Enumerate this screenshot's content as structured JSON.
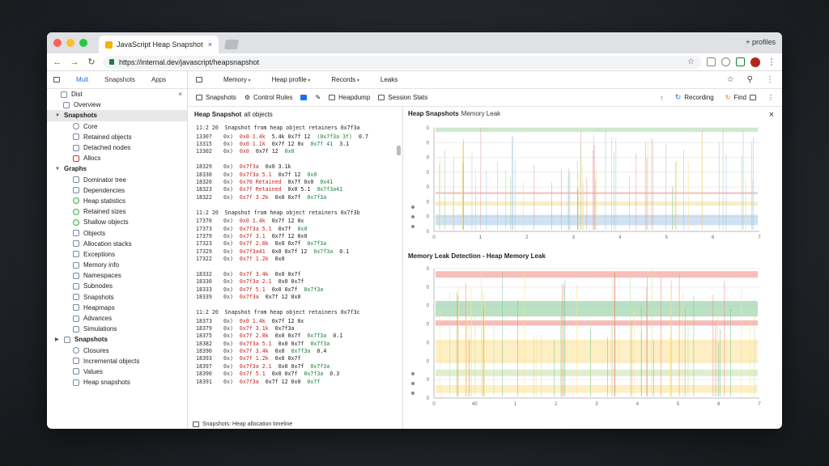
{
  "browser": {
    "tab_title": "JavaScript Heap Snapshot",
    "tab_close": "×",
    "window_label": "+ profiles",
    "url": "https://internal.dev/javascript/heapsnapshot",
    "traffic_lights": [
      "#ff5f57",
      "#febc2e",
      "#28c840"
    ]
  },
  "sidebar": {
    "tabs": [
      "Mult",
      "Snapshots",
      "Apps"
    ],
    "items": [
      {
        "label": "Dist",
        "kind": "root",
        "icon": "square-icon"
      },
      {
        "label": "Overview",
        "kind": "leaf",
        "icon": "square-icon"
      },
      {
        "label": "Snapshots",
        "kind": "group",
        "icon": "none"
      },
      {
        "label": "Core",
        "kind": "leaf",
        "icon": "circle-icon"
      },
      {
        "label": "Retained objects",
        "kind": "leaf",
        "icon": "square-icon"
      },
      {
        "label": "Detached nodes",
        "kind": "leaf",
        "icon": "square-icon"
      },
      {
        "label": "Allocs",
        "kind": "leaf",
        "icon": "red-icon"
      },
      {
        "label": "Graphs",
        "kind": "group",
        "icon": "none"
      },
      {
        "label": "Dominator tree",
        "kind": "leaf",
        "icon": "square-icon"
      },
      {
        "label": "Dependencies",
        "kind": "leaf",
        "icon": "square-icon"
      },
      {
        "label": "Heap statistics",
        "kind": "leaf",
        "icon": "green-icon"
      },
      {
        "label": "Retained sizes",
        "kind": "leaf",
        "icon": "green-icon"
      },
      {
        "label": "Shallow objects",
        "kind": "leaf",
        "icon": "green-icon"
      },
      {
        "label": "Objects",
        "kind": "leaf",
        "icon": "square-icon"
      },
      {
        "label": "Allocation stacks",
        "kind": "leaf",
        "icon": "square-icon"
      },
      {
        "label": "Exceptions",
        "kind": "leaf",
        "icon": "square-icon"
      },
      {
        "label": "Memory info",
        "kind": "leaf",
        "icon": "square-icon"
      },
      {
        "label": "Namespaces",
        "kind": "leaf",
        "icon": "square-icon"
      },
      {
        "label": "Subnodes",
        "kind": "leaf",
        "icon": "square-icon"
      },
      {
        "label": "Snapshots",
        "kind": "leaf",
        "icon": "square-icon"
      },
      {
        "label": "Heapmaps",
        "kind": "leaf",
        "icon": "square-icon"
      },
      {
        "label": "Advances",
        "kind": "leaf",
        "icon": "square-icon"
      },
      {
        "label": "Simulations",
        "kind": "leaf",
        "icon": "square-icon"
      },
      {
        "label": "Snapshots",
        "kind": "group",
        "icon": "square-icon"
      },
      {
        "label": "Closures",
        "kind": "leaf",
        "icon": "circle-icon"
      },
      {
        "label": "Incremental objects",
        "kind": "leaf",
        "icon": "square-icon"
      },
      {
        "label": "Values",
        "kind": "leaf",
        "icon": "square-icon"
      },
      {
        "label": "Heap snapshots",
        "kind": "leaf",
        "icon": "square-icon"
      }
    ]
  },
  "toolbar": {
    "items": [
      "Memory",
      "Heap profile",
      "Records",
      "Leaks"
    ],
    "snapshots_label": "Snapshots",
    "control_label": "Control Rules",
    "heap_label": "Heapdump",
    "session_label": "Session Stats",
    "recording_label": "Recording",
    "find_label": "Find"
  },
  "code": {
    "header": "Heap Snapshot",
    "header_sub": "all objects",
    "blocks": [
      {
        "head_num": "11:2 20",
        "head_text": "Snapshot from heap object retainers 0x7f3a",
        "lines": [
          {
            "ln": "13307",
            "a": "0x)",
            "b": "0x0 1.4k",
            "c": "5.4k 0x7f 12",
            "d": "(0x7f3a 3f)",
            "e": "0.7"
          },
          {
            "ln": "13315",
            "a": "0x)",
            "b": "0x0 1.1k",
            "c": "0x7f 12 0x",
            "d": "0x7f 41",
            "e": "3.1"
          },
          {
            "ln": "13302",
            "a": "0x)",
            "b": "0x0",
            "c": "0x7f 12",
            "d": "0x0",
            "e": ""
          },
          {
            "ln": "",
            "a": "",
            "b": "",
            "c": "",
            "d": "",
            "e": ""
          },
          {
            "ln": "18329",
            "a": "0x)",
            "b": "0x7f3a",
            "c": "0x0 3.1k",
            "d": "",
            "e": ""
          },
          {
            "ln": "18330",
            "a": "0x)",
            "b": "0x7f3a 5.1",
            "c": "0x7f 12",
            "d": "0x0",
            "e": ""
          },
          {
            "ln": "18320",
            "a": "0x)",
            "b": "0x70 Retained",
            "c": "0x7f 0x0",
            "d": "0x41",
            "e": ""
          },
          {
            "ln": "18323",
            "a": "0x)",
            "b": "0x7f Retained",
            "c": "0x0 5.1",
            "d": "0x7f3a41",
            "e": ""
          },
          {
            "ln": "18322",
            "a": "0x)",
            "b": "0x7f 3.2k",
            "c": "0x0 0x7f",
            "d": "0x7f3a",
            "e": ""
          }
        ]
      },
      {
        "head_num": "11:2 20",
        "head_text": "Snapshot from heap object retainers 0x7f3b",
        "lines": [
          {
            "ln": "17370",
            "a": "0x)",
            "b": "0x0 1.4k",
            "c": "0x7f 12 0x",
            "d": "",
            "e": ""
          },
          {
            "ln": "17373",
            "a": "0x)",
            "b": "0x7f3a 5.1",
            "c": "0x7f",
            "d": "0x0",
            "e": ""
          },
          {
            "ln": "17379",
            "a": "0x)",
            "b": "0x7f 3.1",
            "c": "0x7f 12 0x0",
            "d": "",
            "e": ""
          },
          {
            "ln": "17323",
            "a": "0x)",
            "b": "0x7f 2.8k",
            "c": "0x0 0x7f",
            "d": "0x7f3a",
            "e": ""
          },
          {
            "ln": "17329",
            "a": "0x)",
            "b": "0x7f3a41",
            "c": "0x0 0x7f 12",
            "d": "0x7f3a",
            "e": "0.1"
          },
          {
            "ln": "17322",
            "a": "0x)",
            "b": "0x7f 1.2k",
            "c": "0x0",
            "d": "",
            "e": ""
          },
          {
            "ln": "",
            "a": "",
            "b": "",
            "c": "",
            "d": "",
            "e": ""
          },
          {
            "ln": "18332",
            "a": "0x)",
            "b": "0x7f 3.4k",
            "c": "0x0 0x7f",
            "d": "",
            "e": ""
          },
          {
            "ln": "18330",
            "a": "0x)",
            "b": "0x7f3a 2.1",
            "c": "0x0 0x7f",
            "d": "",
            "e": ""
          },
          {
            "ln": "18333",
            "a": "0x)",
            "b": "0x7f 5.1",
            "c": "0x0 0x7f",
            "d": "0x7f3a",
            "e": ""
          },
          {
            "ln": "18339",
            "a": "0x)",
            "b": "0x7f3a",
            "c": "0x7f 12 0x0",
            "d": "",
            "e": ""
          }
        ]
      },
      {
        "head_num": "11:2 20",
        "head_text": "Snapshot from heap object retainers 0x7f3c",
        "lines": [
          {
            "ln": "18373",
            "a": "0x)",
            "b": "0x0 1.4k",
            "c": "0x7f 12 0x",
            "d": "",
            "e": ""
          },
          {
            "ln": "18379",
            "a": "0x)",
            "b": "0x7f 3.1k",
            "c": "0x7f3a",
            "d": "",
            "e": ""
          },
          {
            "ln": "18375",
            "a": "0x)",
            "b": "0x7f 2.8k",
            "c": "0x0 0x7f",
            "d": "0x7f3a",
            "e": "0.1"
          },
          {
            "ln": "18382",
            "a": "0x)",
            "b": "0x7f3a 5.1",
            "c": "0x0 0x7f",
            "d": "0x7f3a",
            "e": ""
          },
          {
            "ln": "18390",
            "a": "0x)",
            "b": "0x7f 3.4k",
            "c": "0x0",
            "d": "0x7f3a",
            "e": "0.4"
          },
          {
            "ln": "18393",
            "a": "0x)",
            "b": "0x7f 1.2k",
            "c": "0x0 0x7f",
            "d": "",
            "e": ""
          },
          {
            "ln": "18397",
            "a": "0x)",
            "b": "0x7f3a 2.1",
            "c": "0x0 0x7f",
            "d": "0x7f3a",
            "e": ""
          },
          {
            "ln": "18390",
            "a": "0x)",
            "b": "0x7f 5.1",
            "c": "0x0 0x7f",
            "d": "0x7f3a",
            "e": "0.3"
          },
          {
            "ln": "18391",
            "a": "0x)",
            "b": "0x7f3a",
            "c": "0x7f 12 0x0",
            "d": "0x7f",
            "e": ""
          }
        ]
      }
    ],
    "footer": "Snapshots: Heap allocation timeline"
  },
  "charts": {
    "chart1_title": "Heap Snapshots",
    "chart1_sub": "Memory Leak",
    "chart2_title": "Memory Leak Detection - Heap Memory Leak",
    "close": "×"
  },
  "chart_data": [
    {
      "type": "line",
      "title": "Heap Snapshots",
      "x": [
        "0",
        "1",
        "2",
        "3",
        "4",
        "5",
        "6",
        "7"
      ],
      "series_colors": [
        "#e8a0a0",
        "#a8d8a8",
        "#a8c8e8",
        "#f2e08a"
      ],
      "yticks": [
        "0",
        "0",
        "0",
        "0",
        "0",
        "0",
        "0",
        "0"
      ]
    },
    {
      "type": "line",
      "title": "Memory Leak Detection - Heap Memory Leak",
      "x": [
        "0",
        "40",
        "1",
        "2",
        "3",
        "4",
        "5",
        "6",
        "7"
      ],
      "series_colors": [
        "#f28b82",
        "#81c995",
        "#fde293",
        "#c5e1a5"
      ],
      "yticks": [
        "0",
        "0",
        "0",
        "0",
        "0",
        "0",
        "0",
        "0"
      ]
    }
  ]
}
